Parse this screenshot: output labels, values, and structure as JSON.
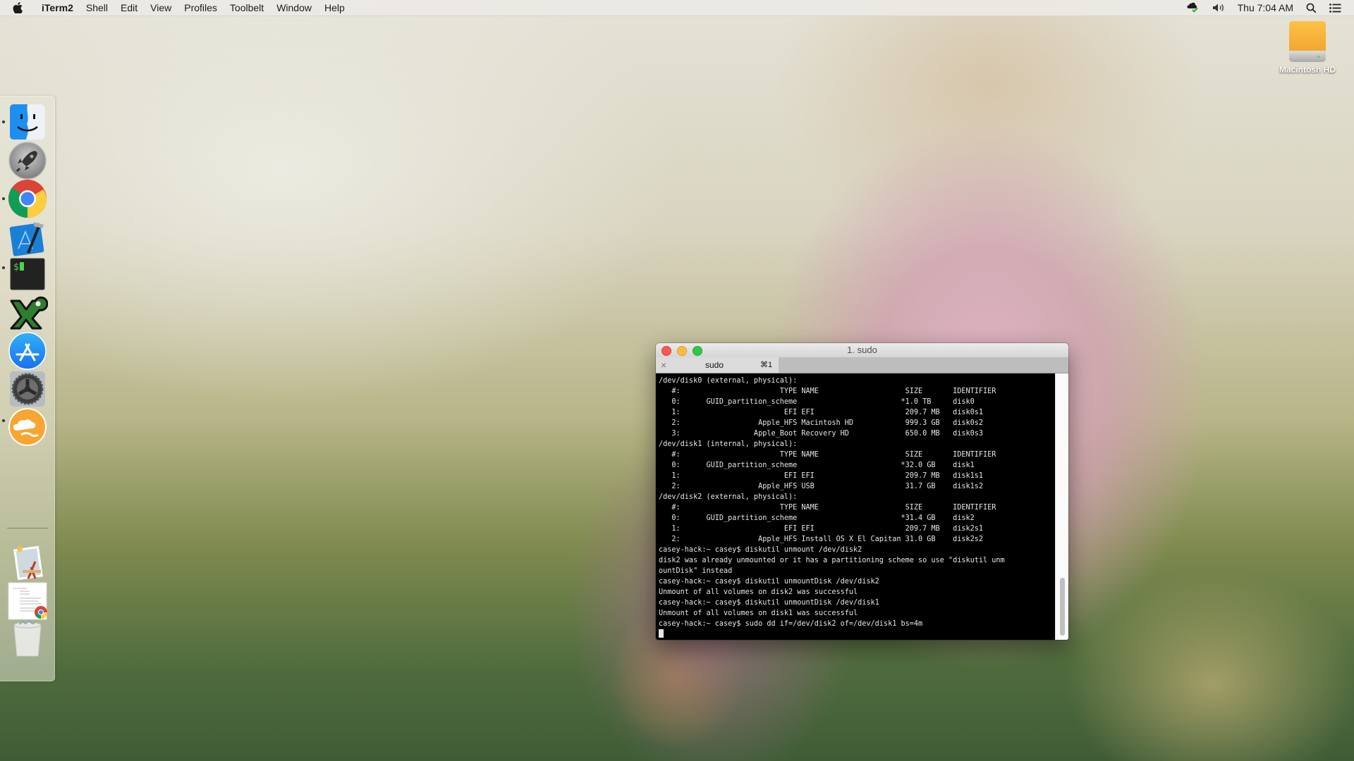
{
  "menubar": {
    "apple_icon": "apple-logo",
    "app_name": "iTerm2",
    "items": [
      "Shell",
      "Edit",
      "View",
      "Profiles",
      "Toolbelt",
      "Window",
      "Help"
    ],
    "status": {
      "sync_icon": "cloud-sync-icon",
      "volume_icon": "volume-icon",
      "clock": "Thu 7:04 AM",
      "spotlight_icon": "search-icon",
      "notification_icon": "list-icon"
    }
  },
  "desktop": {
    "icons": [
      {
        "label": "Macintosh HD",
        "icon": "hard-drive-icon"
      }
    ]
  },
  "dock": {
    "items": [
      {
        "name": "Finder",
        "icon": "finder-icon",
        "running": true
      },
      {
        "name": "Launchpad",
        "icon": "launchpad-rocket-icon",
        "running": false
      },
      {
        "name": "Google Chrome",
        "icon": "chrome-icon",
        "running": true
      },
      {
        "name": "Xcode",
        "icon": "xcode-icon",
        "running": false
      },
      {
        "name": "iTerm2",
        "icon": "terminal-icon",
        "running": true
      },
      {
        "name": "XQuartz",
        "icon": "x11-icon",
        "running": false
      },
      {
        "name": "App Store",
        "icon": "app-store-icon",
        "running": false
      },
      {
        "name": "System Preferences",
        "icon": "gear-icon",
        "running": false
      },
      {
        "name": "Cloud App",
        "icon": "cloud-app-icon",
        "running": true
      }
    ],
    "stack_items": [
      {
        "name": "Applications",
        "icon": "applications-folder-icon"
      },
      {
        "name": "Document",
        "icon": "chrome-document-icon"
      },
      {
        "name": "Trash",
        "icon": "trash-icon"
      }
    ]
  },
  "terminal": {
    "window_title": "1. sudo",
    "colors": {
      "close": "#fc5753",
      "minimize": "#fdbc40",
      "zoom": "#33c748"
    },
    "tabs": [
      {
        "label": "sudo",
        "shortcut": "⌘1",
        "active": true
      }
    ],
    "lines": [
      "/dev/disk0 (external, physical):",
      "   #:                       TYPE NAME                    SIZE       IDENTIFIER",
      "   0:      GUID_partition_scheme                        *1.0 TB     disk0",
      "   1:                        EFI EFI                     209.7 MB   disk0s1",
      "   2:                  Apple_HFS Macintosh HD            999.3 GB   disk0s2",
      "   3:                 Apple_Boot Recovery HD             650.0 MB   disk0s3",
      "/dev/disk1 (internal, physical):",
      "   #:                       TYPE NAME                    SIZE       IDENTIFIER",
      "   0:      GUID_partition_scheme                        *32.0 GB    disk1",
      "   1:                        EFI EFI                     209.7 MB   disk1s1",
      "   2:                  Apple_HFS USB                     31.7 GB    disk1s2",
      "/dev/disk2 (external, physical):",
      "   #:                       TYPE NAME                    SIZE       IDENTIFIER",
      "   0:      GUID_partition_scheme                        *31.4 GB    disk2",
      "   1:                        EFI EFI                     209.7 MB   disk2s1",
      "   2:                  Apple_HFS Install OS X El Capitan 31.0 GB    disk2s2",
      "casey-hack:~ casey$ diskutil unmount /dev/disk2",
      "disk2 was already unmounted or it has a partitioning scheme so use \"diskutil unm",
      "ountDisk\" instead",
      "casey-hack:~ casey$ diskutil unmountDisk /dev/disk2",
      "Unmount of all volumes on disk2 was successful",
      "casey-hack:~ casey$ diskutil unmountDisk /dev/disk1",
      "Unmount of all volumes on disk1 was successful",
      "casey-hack:~ casey$ sudo dd if=/dev/disk2 of=/dev/disk1 bs=4m"
    ]
  }
}
